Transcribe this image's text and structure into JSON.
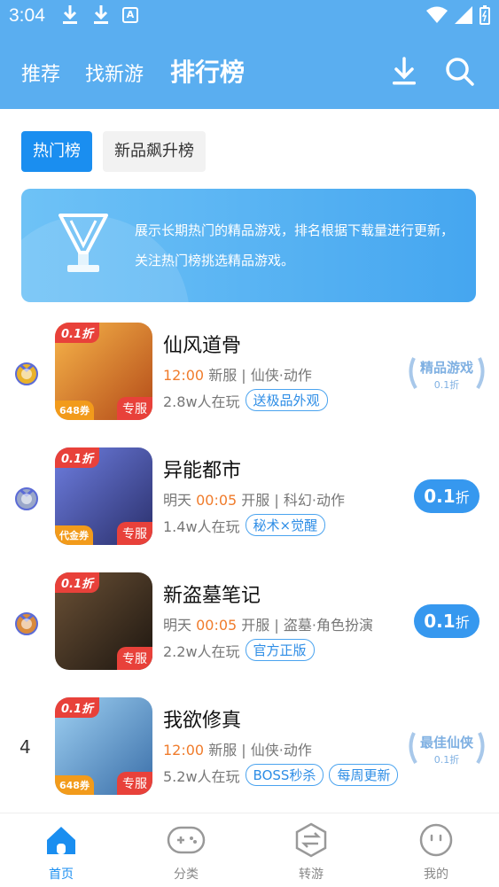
{
  "status": {
    "time": "3:04"
  },
  "nav": {
    "tabs": [
      "推荐",
      "找新游",
      "排行榜"
    ]
  },
  "subtabs": [
    "热门榜",
    "新品飙升榜"
  ],
  "banner": {
    "text": "展示长期热门的精品游戏，排名根据下载量进行更新，关注热门榜挑选精品游戏。"
  },
  "games": [
    {
      "rank": "1",
      "title": "仙风道骨",
      "badge_top": "0.1折",
      "badge_bl": "648券",
      "badge_br": "专服",
      "meta_pre": "",
      "meta_time": "12:00",
      "meta_post": " 新服 | 仙侠·动作",
      "players": "2.8w人在玩",
      "tags": [
        "送极品外观"
      ],
      "award": "精品游戏",
      "award_sub": "0.1折",
      "colors": [
        "#f7b54a",
        "#b34a18"
      ]
    },
    {
      "rank": "2",
      "title": "异能都市",
      "badge_top": "0.1折",
      "badge_bl": "代金券",
      "badge_br": "专服",
      "meta_pre": "明天 ",
      "meta_time": "00:05",
      "meta_post": " 开服 | 科幻·动作",
      "players": "1.4w人在玩",
      "tags": [
        "秘术×觉醒"
      ],
      "pill": "0.1",
      "pill_unit": "折",
      "colors": [
        "#6e7ee0",
        "#2a2f6b"
      ]
    },
    {
      "rank": "3",
      "title": "新盗墓笔记",
      "badge_top": "0.1折",
      "badge_bl": "",
      "badge_br": "专服",
      "meta_pre": "明天 ",
      "meta_time": "00:05",
      "meta_post": " 开服 | 盗墓·角色扮演",
      "players": "2.2w人在玩",
      "tags": [
        "官方正版"
      ],
      "pill": "0.1",
      "pill_unit": "折",
      "colors": [
        "#6b5136",
        "#1d1610"
      ]
    },
    {
      "rank": "4",
      "title": "我欲修真",
      "badge_top": "0.1折",
      "badge_bl": "648券",
      "badge_br": "专服",
      "meta_pre": "",
      "meta_time": "12:00",
      "meta_post": " 新服 | 仙侠·动作",
      "players": "5.2w人在玩",
      "tags": [
        "BOSS秒杀",
        "每周更新"
      ],
      "award": "最佳仙侠",
      "award_sub": "0.1折",
      "colors": [
        "#9ed0f2",
        "#3a6ea8"
      ]
    }
  ],
  "bottom_nav": [
    "首页",
    "分类",
    "转游",
    "我的"
  ],
  "colors": {
    "header": "#5aaef0",
    "accent": "#1a8ef0",
    "highlight": "#f07c2c"
  }
}
